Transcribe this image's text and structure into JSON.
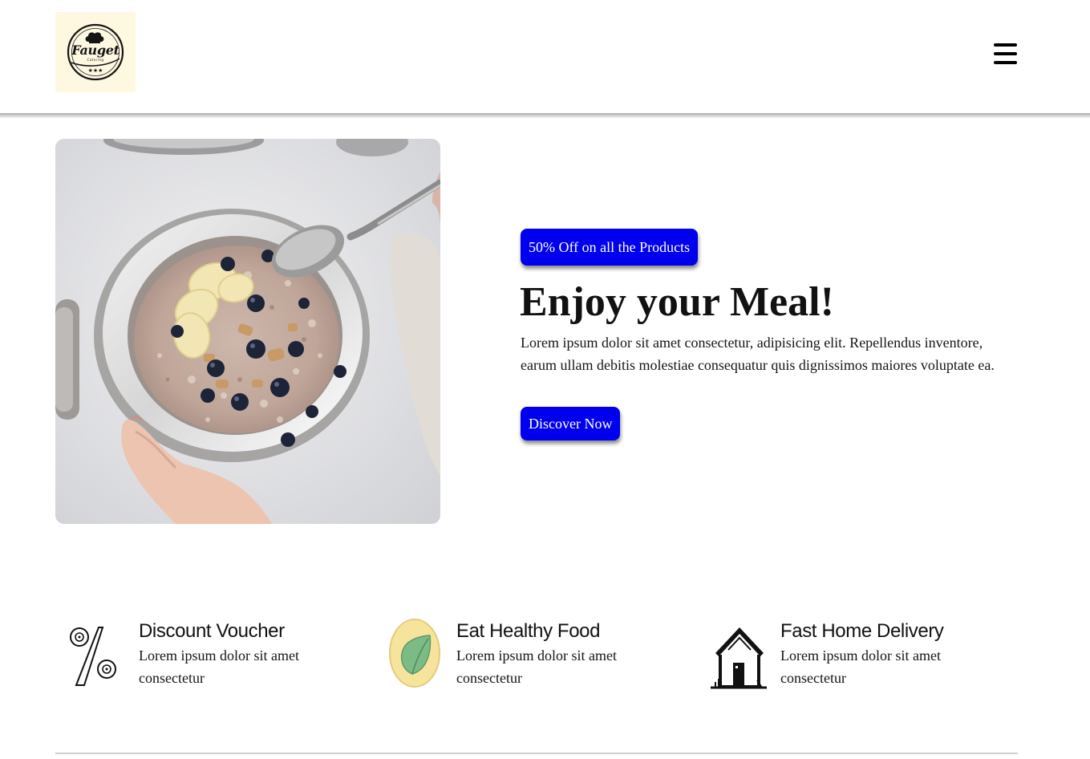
{
  "header": {
    "logo": {
      "name": "Fauget",
      "tagline": "Catering",
      "icon": "chef-hat-bowl-logo",
      "background_color": "#fef8e1"
    },
    "menu_icon": "hamburger-menu-icon"
  },
  "hero": {
    "image_description": "bowl of oatmeal with banana slices, blueberries and granola held in hands",
    "promo_badge": "50% Off on all the Products",
    "title": "Enjoy your Meal!",
    "text": "Lorem ipsum dolor sit amet consectetur, adipisicing elit. Repellendus inventore, earum ullam debitis molestiae consequatur quis dignissimos maiores voluptate ea.",
    "cta_label": "Discover Now",
    "accent_color": "#0000ee"
  },
  "features": [
    {
      "icon": "percent-icon",
      "title": "Discount Voucher",
      "text": "Lorem ipsum dolor sit amet consectetur"
    },
    {
      "icon": "leaf-icon",
      "title": "Eat Healthy Food",
      "text": "Lorem ipsum dolor sit amet consectetur"
    },
    {
      "icon": "house-icon",
      "title": "Fast Home Delivery",
      "text": "Lorem ipsum dolor sit amet consectetur"
    }
  ]
}
